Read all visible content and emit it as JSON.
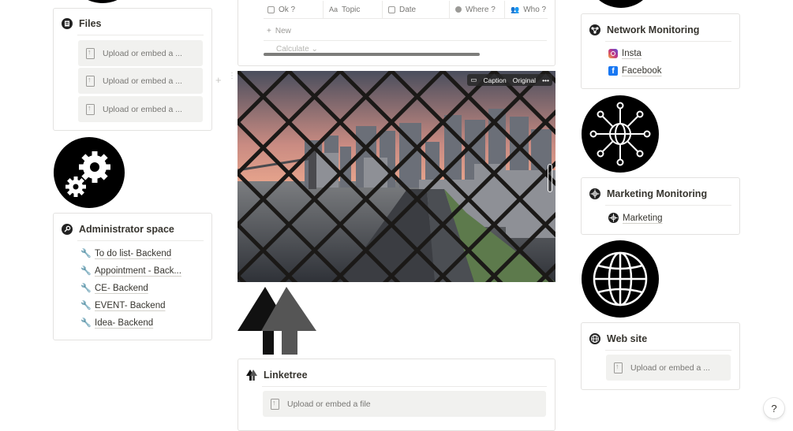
{
  "left": {
    "files": {
      "title": "Files",
      "uploads": [
        "Upload or embed a ...",
        "Upload or embed a ...",
        "Upload or embed a ..."
      ]
    },
    "admin": {
      "title": "Administrator space",
      "items": [
        "To do list- Backend",
        "Appointment - Back...",
        "CE- Backend",
        "EVENT- Backend",
        "Idea- Backend"
      ]
    }
  },
  "center": {
    "table": {
      "columns": [
        "Ok ?",
        "Topic",
        "Date",
        "Where ?",
        "Who ?"
      ],
      "new_label": "New",
      "calculate_label": "Calculate"
    },
    "image_toolbar": {
      "caption": "Caption",
      "original": "Original",
      "more": "•••"
    },
    "linktree": {
      "title": "Linketree",
      "upload": "Upload or embed a file"
    }
  },
  "right": {
    "network": {
      "title": "Network Monitoring",
      "items": [
        "Insta",
        "Facebook"
      ]
    },
    "marketing": {
      "title": "Marketing Monitoring",
      "items": [
        "Marketing"
      ]
    },
    "website": {
      "title": "Web site",
      "upload": "Upload or embed a ..."
    }
  },
  "help": {
    "label": "?"
  },
  "colors": {
    "accent": "#37352f",
    "instagram": "#c13584",
    "facebook": "#1877f2"
  }
}
